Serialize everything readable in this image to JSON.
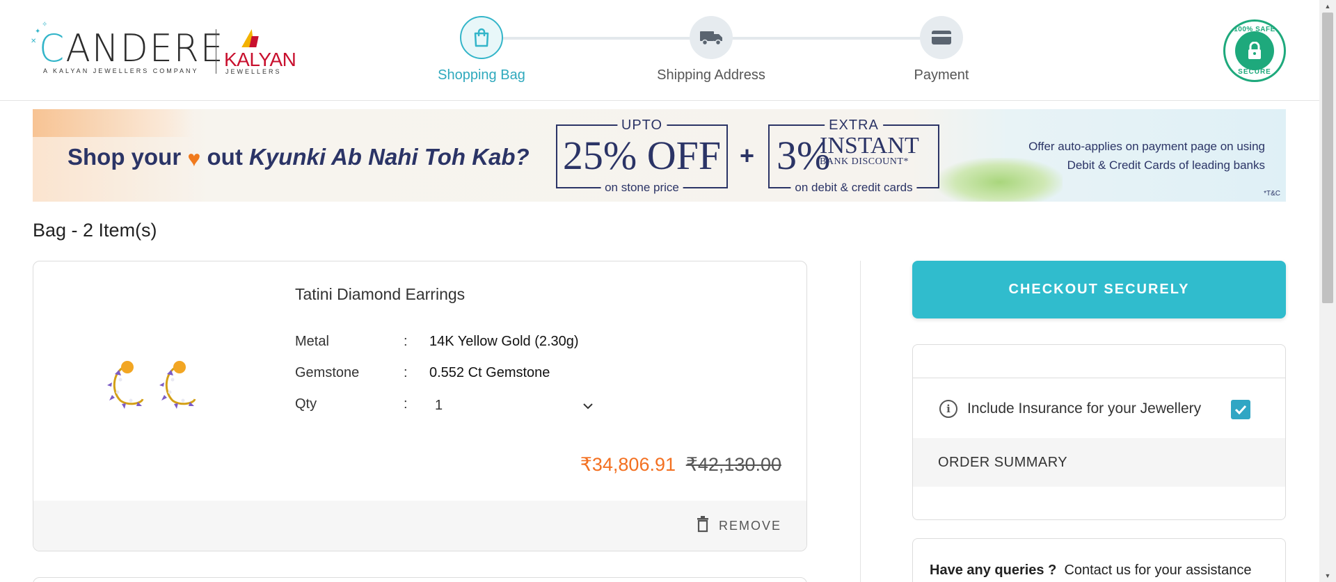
{
  "header": {
    "logo_brand": "CANDERE",
    "logo_tagline": "A KALYAN JEWELLERS COMPANY",
    "partner_brand": "KALYAN",
    "partner_sub": "JEWELLERS",
    "steps": [
      {
        "label": "Shopping Bag",
        "icon": "bag-icon",
        "active": true
      },
      {
        "label": "Shipping Address",
        "icon": "truck-icon",
        "active": false
      },
      {
        "label": "Payment",
        "icon": "card-icon",
        "active": false
      }
    ],
    "badge_top": "100% SAFE",
    "badge_bottom": "SECURE"
  },
  "banner": {
    "headline_start": "Shop your",
    "headline_mid": "out",
    "headline_italic": "Kyunki Ab Nahi Toh Kab?",
    "offer1_top": "UPTO",
    "offer1_big": "25% OFF",
    "offer1_bottom": "on stone price",
    "plus": "+",
    "offer2_top": "EXTRA",
    "offer2_pct": "3%",
    "offer2_instant": "INSTANT",
    "offer2_bank": "BANK DISCOUNT*",
    "offer2_bottom": "on debit & credit cards",
    "note_line1": "Offer auto-applies on payment page on using",
    "note_line2": "Debit & Credit Cards of leading banks",
    "tc": "*T&C"
  },
  "bag": {
    "title": "Bag -  2 Item(s)",
    "item": {
      "name": "Tatini Diamond Earrings",
      "metal_label": "Metal",
      "metal_value": "14K Yellow Gold (2.30g)",
      "gem_label": "Gemstone",
      "gem_value": "0.552 Ct Gemstone",
      "qty_label": "Qty",
      "qty_value": "1",
      "colon": ":",
      "price": "₹34,806.91",
      "original_price": "₹42,130.00",
      "remove_label": "REMOVE"
    }
  },
  "sidebar": {
    "checkout_label": "CHECKOUT SECURELY",
    "insurance_label": "Include Insurance for your Jewellery",
    "insurance_checked": true,
    "order_summary_label": "ORDER SUMMARY",
    "queries_label": "Have any queries ?",
    "queries_link": "Contact us for your assistance"
  },
  "colors": {
    "accent": "#30bccd",
    "price": "#f37021",
    "banner_text": "#2b3466",
    "badge": "#1ea97c"
  }
}
